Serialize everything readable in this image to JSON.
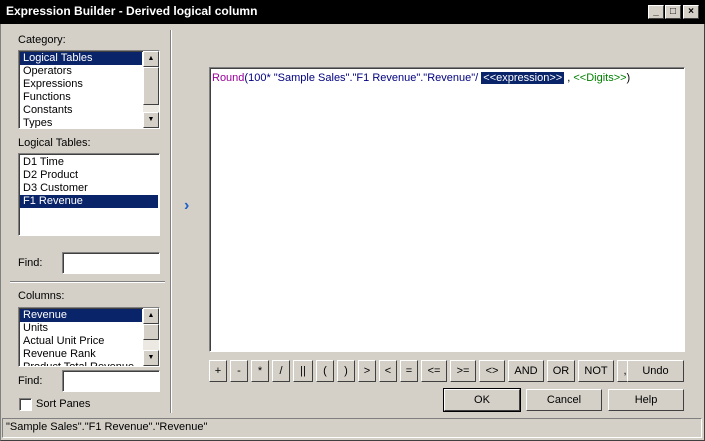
{
  "window": {
    "title": "Expression Builder - Derived logical column",
    "minimize_glyph": "_",
    "maximize_glyph": "□",
    "close_glyph": "×"
  },
  "category": {
    "label": "Category:",
    "items": [
      "Logical Tables",
      "Operators",
      "Expressions",
      "Functions",
      "Constants",
      "Types"
    ],
    "selected": "Logical Tables"
  },
  "logical_tables": {
    "label": "Logical Tables:",
    "items": [
      "D1 Time",
      "D2 Product",
      "D3 Customer",
      "F1 Revenue"
    ],
    "selected": "F1 Revenue"
  },
  "find_top": {
    "label": "Find:",
    "value": ""
  },
  "columns": {
    "label": "Columns:",
    "items": [
      "Revenue",
      "Units",
      "Actual Unit Price",
      "Revenue Rank",
      "Product Total Revenue"
    ],
    "selected": "Revenue"
  },
  "find_bottom": {
    "label": "Find:",
    "value": ""
  },
  "sort_panes": {
    "label": "Sort Panes",
    "checked": false
  },
  "insert_arrow": "›",
  "expression": {
    "func": "Round",
    "part1": "(100* ",
    "column_ref": "\"Sample Sales\".\"F1 Revenue\".\"Revenue\"",
    "part2": "/ ",
    "placeholder1": "<<expression>>",
    "part3": " , ",
    "placeholder2": "<<Digits>>",
    "part4": ")"
  },
  "operators": [
    "+",
    "-",
    "*",
    "/",
    "||",
    "(",
    ")",
    ">",
    "<",
    "=",
    "<=",
    ">=",
    "<>",
    "AND",
    "OR",
    "NOT",
    ","
  ],
  "buttons": {
    "undo": "Undo",
    "ok": "OK",
    "cancel": "Cancel",
    "help": "Help"
  },
  "status": "\"Sample Sales\".\"F1 Revenue\".\"Revenue\""
}
